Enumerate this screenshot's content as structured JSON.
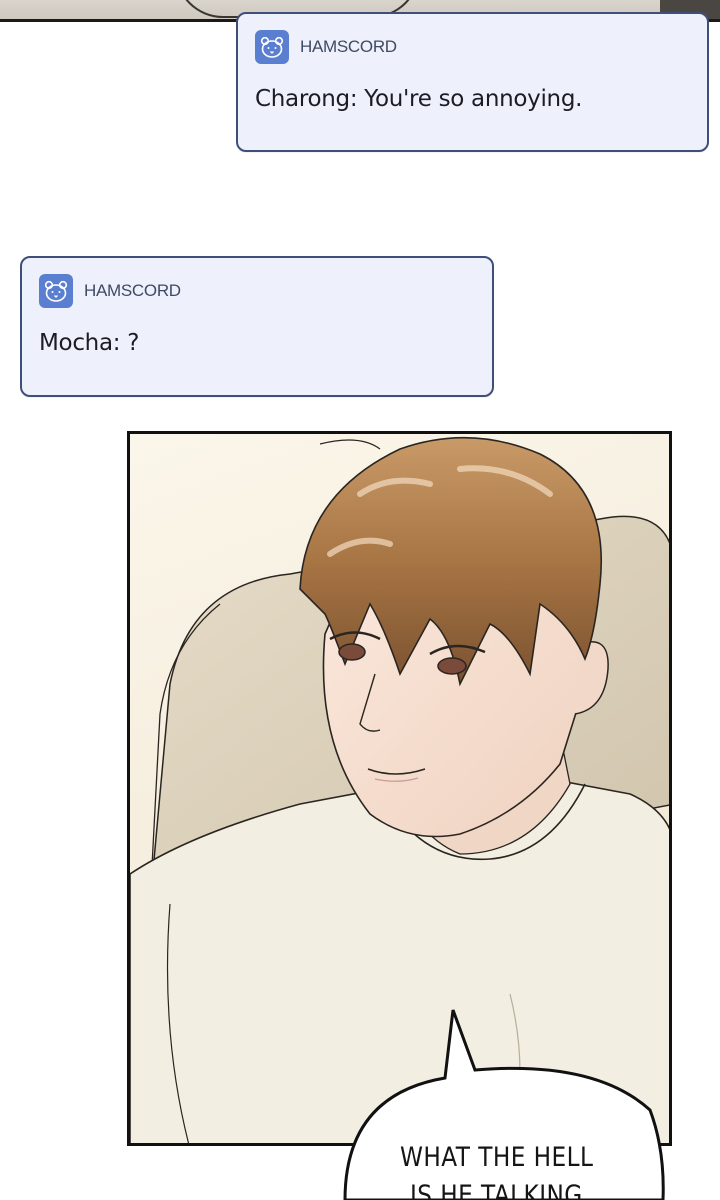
{
  "notifications": [
    {
      "app_name": "HAMSCORD",
      "app_icon": "hamster-icon",
      "message": "Charong: You're so annoying."
    },
    {
      "app_name": "HAMSCORD",
      "app_icon": "hamster-icon",
      "message": "Mocha: ?"
    }
  ],
  "speech_bubble": {
    "line1": "WHAT THE HELL",
    "line2": "IS HE TALKING"
  },
  "colors": {
    "notification_bg": "#eef1fc",
    "notification_border": "#3e4f7a",
    "app_icon_bg": "#5b7fd0"
  }
}
